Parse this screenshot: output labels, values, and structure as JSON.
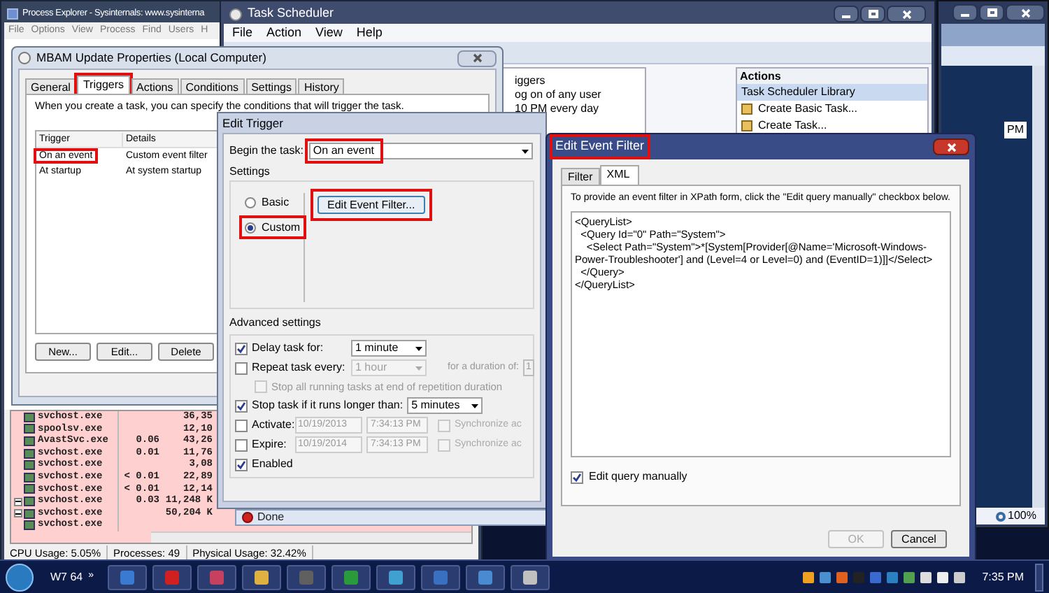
{
  "process_explorer": {
    "title": "Process Explorer - Sysinternals: www.sysinterna",
    "menu": [
      "File",
      "Options",
      "View",
      "Process",
      "Find",
      "Users",
      "H"
    ],
    "processes": [
      {
        "name": "svchost.exe",
        "memory": "36,35",
        "expandable": false
      },
      {
        "name": "spoolsv.exe",
        "memory": "12,10",
        "expandable": false
      },
      {
        "name": "AvastSvc.exe",
        "cpu": "0.06",
        "memory": "43,26",
        "expandable": false
      },
      {
        "name": "svchost.exe",
        "cpu": "0.01",
        "memory": "11,76",
        "expandable": false
      },
      {
        "name": "svchost.exe",
        "memory": "3,08",
        "expandable": false
      },
      {
        "name": "svchost.exe",
        "cpu": "< 0.01",
        "memory": "22,89",
        "expandable": false
      },
      {
        "name": "svchost.exe",
        "cpu": "< 0.01",
        "memory": "12,14",
        "expandable": false
      },
      {
        "name": "svchost.exe",
        "cpu": "0.03",
        "memory": "11,248 K",
        "expandable": true
      },
      {
        "name": "svchost.exe",
        "memory": "50,204 K",
        "expandable": true
      },
      {
        "name": "svchost.exe",
        "expandable": false
      }
    ],
    "status_bar": [
      "CPU Usage: 5.05%",
      "Processes: 49",
      "Physical Usage: 32.42%"
    ]
  },
  "task_scheduler": {
    "title": "Task Scheduler",
    "menu": [
      "File",
      "Action",
      "View",
      "Help"
    ],
    "center_lines": [
      "iggers",
      "og on of any user",
      "10 PM every day"
    ],
    "actions": {
      "title": "Actions",
      "section": "Task Scheduler Library",
      "items": [
        "Create Basic Task...",
        "Create Task..."
      ]
    }
  },
  "browser": {
    "fragment": "PM",
    "zoom": "100%"
  },
  "status_window": {
    "text": "Done"
  },
  "properties_dialog": {
    "title": "MBAM Update Properties (Local Computer)",
    "tabs": [
      {
        "label": "General",
        "selected": false,
        "highlighted": false
      },
      {
        "label": "Triggers",
        "selected": true,
        "highlighted": true
      },
      {
        "label": "Actions",
        "selected": false,
        "highlighted": false
      },
      {
        "label": "Conditions",
        "selected": false,
        "highlighted": false
      },
      {
        "label": "Settings",
        "selected": false,
        "highlighted": false
      },
      {
        "label": "History",
        "selected": false,
        "highlighted": false
      }
    ],
    "intro": "When you create a task, you can specify the conditions that will trigger the task.",
    "columns": [
      "Trigger",
      "Details"
    ],
    "rows": [
      {
        "trigger": "On an event",
        "details": "Custom event filter",
        "highlighted": true
      },
      {
        "trigger": "At startup",
        "details": "At system startup",
        "highlighted": false
      }
    ],
    "buttons": [
      "New...",
      "Edit...",
      "Delete"
    ]
  },
  "edit_trigger": {
    "title": "Edit Trigger",
    "begin_label": "Begin the task:",
    "begin_value": "On an event",
    "begin_highlighted": true,
    "settings_label": "Settings",
    "modes": [
      {
        "label": "Basic",
        "selected": false,
        "highlighted": false
      },
      {
        "label": "Custom",
        "selected": true,
        "highlighted": true
      }
    ],
    "filter_button": {
      "label": "Edit Event Filter...",
      "highlighted": true
    },
    "advanced_label": "Advanced settings",
    "advanced": [
      {
        "kind": "dropdown",
        "label": "Delay task for:",
        "checked": true,
        "value": "1 minute",
        "disabled": false
      },
      {
        "kind": "dropdown",
        "label": "Repeat task every:",
        "checked": false,
        "value": "1 hour",
        "disabled": true,
        "extra": "for a duration of:",
        "extra_value": "1"
      },
      {
        "kind": "sub_checkbox",
        "label": "Stop all running tasks at end of repetition duration",
        "checked": false
      },
      {
        "kind": "dropdown",
        "label": "Stop task if it runs longer than:",
        "checked": true,
        "value": "5 minutes",
        "disabled": false
      },
      {
        "kind": "datetime",
        "label": "Activate:",
        "checked": false,
        "date": "10/19/2013",
        "time": "7:34:13 PM",
        "sync": "Synchronize ac",
        "sync_checked": false
      },
      {
        "kind": "datetime",
        "label": "Expire:",
        "checked": false,
        "date": "10/19/2014",
        "time": "7:34:13 PM",
        "sync": "Synchronize ac",
        "sync_checked": false
      },
      {
        "kind": "checkbox",
        "label": "Enabled",
        "checked": true
      }
    ]
  },
  "event_filter": {
    "title": "Edit Event Filter",
    "title_highlighted": true,
    "tabs": [
      {
        "label": "Filter",
        "selected": false
      },
      {
        "label": "XML",
        "selected": true
      }
    ],
    "instructions": "To provide an event filter in XPath form, click the \"Edit query manually\" checkbox below.",
    "xml_lines": [
      "<QueryList>",
      "  <Query Id=\"0\" Path=\"System\">",
      "    <Select Path=\"System\">*[System[Provider[@Name='Microsoft-Windows-Power-Troubleshooter'] and (Level=4 or Level=0) and (EventID=1)]]</Select>",
      "  </Query>",
      "</QueryList>"
    ],
    "manual": {
      "label": "Edit query manually",
      "checked": true
    },
    "buttons": [
      {
        "label": "OK",
        "disabled": true
      },
      {
        "label": "Cancel",
        "disabled": false
      }
    ]
  },
  "taskbar": {
    "toolbar_label": "W7 64",
    "chevron": "»",
    "clock": "7:35 PM"
  }
}
